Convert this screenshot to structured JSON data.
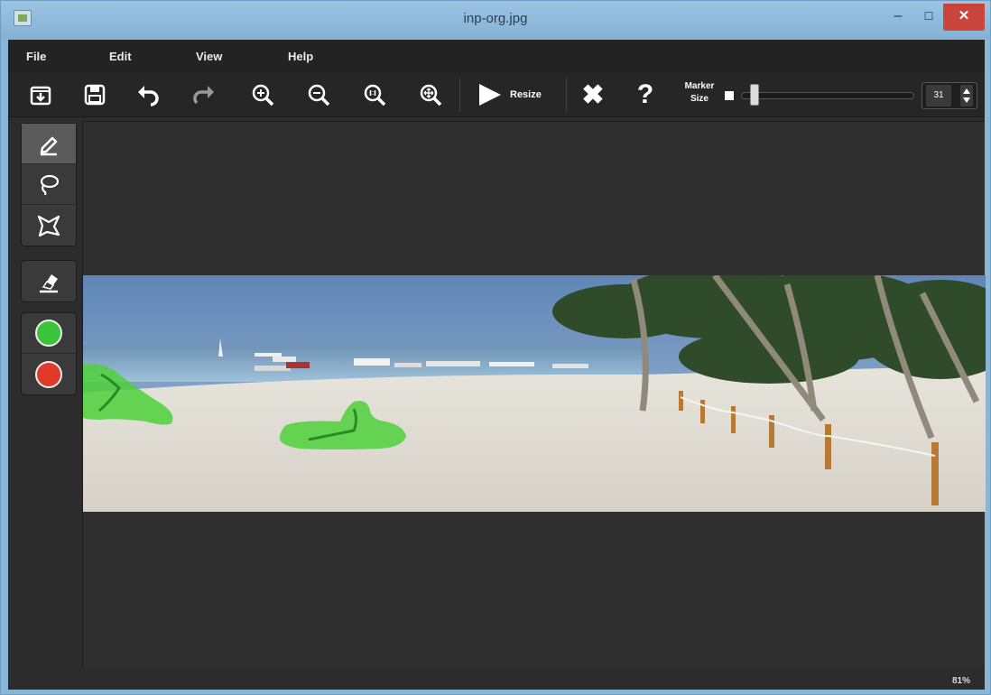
{
  "window": {
    "title": "inp-org.jpg",
    "minimize": "–",
    "maximize": "☐",
    "close": "✕"
  },
  "menu": [
    "File",
    "Edit",
    "View",
    "Help"
  ],
  "toolbar": {
    "buttons": [
      {
        "name": "open-file-icon"
      },
      {
        "name": "save-icon"
      },
      {
        "name": "undo-icon"
      },
      {
        "name": "redo-icon"
      },
      {
        "name": "zoom-in-icon"
      },
      {
        "name": "zoom-out-icon"
      },
      {
        "name": "zoom-actual-icon"
      },
      {
        "name": "zoom-fit-icon"
      }
    ],
    "resize_label": "Resize",
    "clear_icon": "✖",
    "help_icon": "?",
    "marker_size_label": "Marker Size",
    "marker_size_value": "31",
    "marker_size_fraction": 0.05
  },
  "tools": {
    "drawing": [
      "marker-pen-icon",
      "lasso-icon",
      "polygon-icon"
    ],
    "eraser": "eraser-icon",
    "colors": [
      {
        "name": "foreground-green",
        "color": "#3bc43b"
      },
      {
        "name": "background-red",
        "color": "#e03a2a"
      }
    ]
  },
  "status": {
    "zoom": "81%"
  }
}
